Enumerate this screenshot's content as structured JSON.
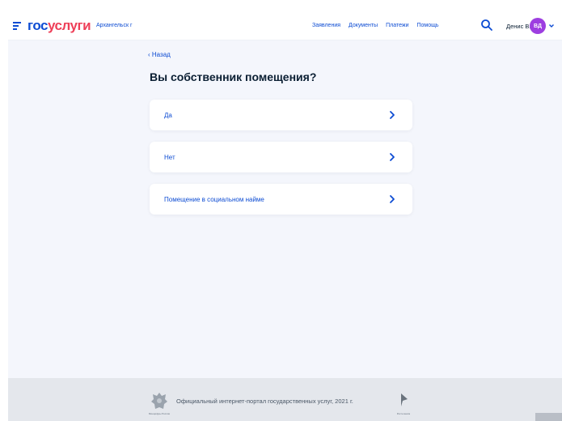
{
  "header": {
    "logo_part1": "гос",
    "logo_part2": "услуги",
    "city": "Архангельск г",
    "nav": [
      "Заявления",
      "Документы",
      "Платежи",
      "Помощь"
    ],
    "user_name": "Денис В.",
    "avatar_initials": "ВД",
    "brand_color": "#0d4cd3",
    "accent_color": "#ee3f58",
    "avatar_color": "#9d3ee0",
    "icons": [
      "menu-icon",
      "search-icon",
      "chevron-down-icon"
    ]
  },
  "main": {
    "back_label": "Назад",
    "title": "Вы собственник помещения?",
    "options": [
      {
        "label": "Да"
      },
      {
        "label": "Нет"
      },
      {
        "label": "Помещение в социальном найме"
      }
    ]
  },
  "footer": {
    "text": "Официальный интернет-портал государственных услуг, 2021 г.",
    "emblem_caption": "Минцифры России",
    "rt_caption": "Ростелеком"
  }
}
